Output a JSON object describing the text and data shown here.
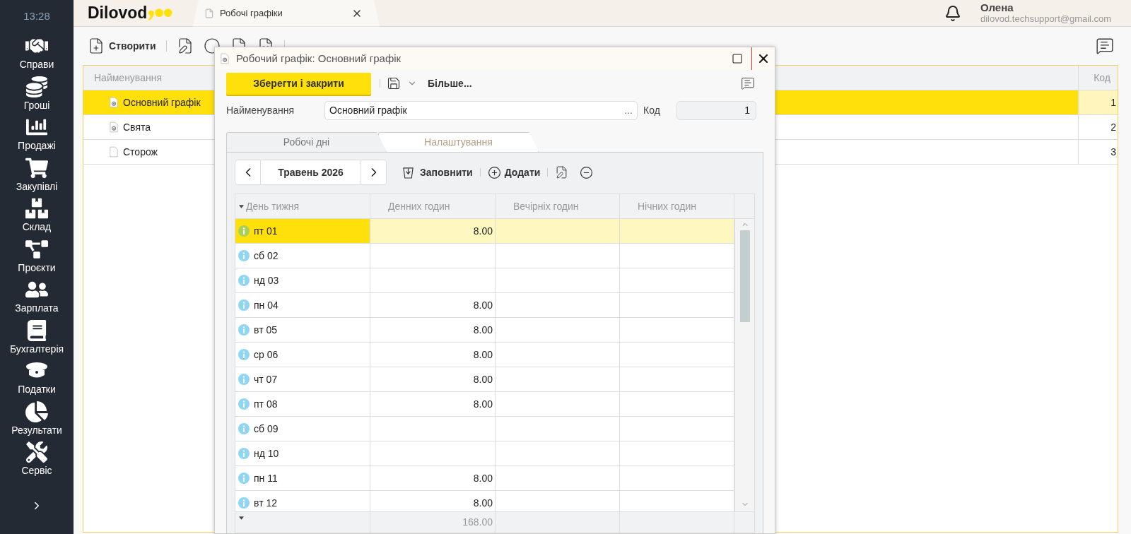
{
  "clock": "13:28",
  "sidebar": {
    "items": [
      {
        "label": "Справи"
      },
      {
        "label": "Гроші"
      },
      {
        "label": "Продажі"
      },
      {
        "label": "Закупівлі"
      },
      {
        "label": "Склад"
      },
      {
        "label": "Проєкти"
      },
      {
        "label": "Зарплата"
      },
      {
        "label": "Бухгалтерія"
      },
      {
        "label": "Податки"
      },
      {
        "label": "Результати"
      },
      {
        "label": "Сервіс"
      }
    ]
  },
  "logo": "Dilovod",
  "document_tab": {
    "label": "Робочі графіки"
  },
  "user": {
    "name": "Олена",
    "email": "dilovod.techsupport@gmail.com"
  },
  "toolbar": {
    "create": "Створити"
  },
  "list": {
    "columns": [
      "Найменування",
      "Код"
    ],
    "rows": [
      {
        "name": "Основний графік",
        "code": "1",
        "kind": "template",
        "selected": true
      },
      {
        "name": "Свята",
        "code": "2",
        "kind": "template",
        "selected": false
      },
      {
        "name": "Сторож",
        "code": "3",
        "kind": "plain",
        "selected": false
      }
    ]
  },
  "dialog": {
    "title": "Робочий графік: Основний графік",
    "save_close": "Зберегти і закрити",
    "more": "Більше...",
    "name_label": "Найменування",
    "name_value": "Основний графік",
    "name_button": "...",
    "code_label": "Код",
    "code_value": "1",
    "tabs": [
      {
        "label": "Робочі дні",
        "selected": true
      },
      {
        "label": "Налаштування",
        "selected": false
      }
    ],
    "month": "Травень 2026",
    "fill": "Заповнити",
    "add": "Додати",
    "columns": [
      "День тижня",
      "Денних годин",
      "Вечірніх годин",
      "Нічних годин"
    ],
    "rows": [
      {
        "day": "пт 01",
        "day_hours": "8.00",
        "selected": true
      },
      {
        "day": "сб 02",
        "selected": false
      },
      {
        "day": "нд 03",
        "selected": false
      },
      {
        "day": "пн 04",
        "day_hours": "8.00",
        "selected": false
      },
      {
        "day": "вт 05",
        "day_hours": "8.00",
        "selected": false
      },
      {
        "day": "ср 06",
        "day_hours": "8.00",
        "selected": false
      },
      {
        "day": "чт 07",
        "day_hours": "8.00",
        "selected": false
      },
      {
        "day": "пт 08",
        "day_hours": "8.00",
        "selected": false
      },
      {
        "day": "сб 09",
        "selected": false
      },
      {
        "day": "нд 10",
        "selected": false
      },
      {
        "day": "пн 11",
        "day_hours": "8.00",
        "selected": false
      },
      {
        "day": "вт 12",
        "day_hours": "8.00",
        "selected": false
      }
    ],
    "total": "168.00"
  }
}
